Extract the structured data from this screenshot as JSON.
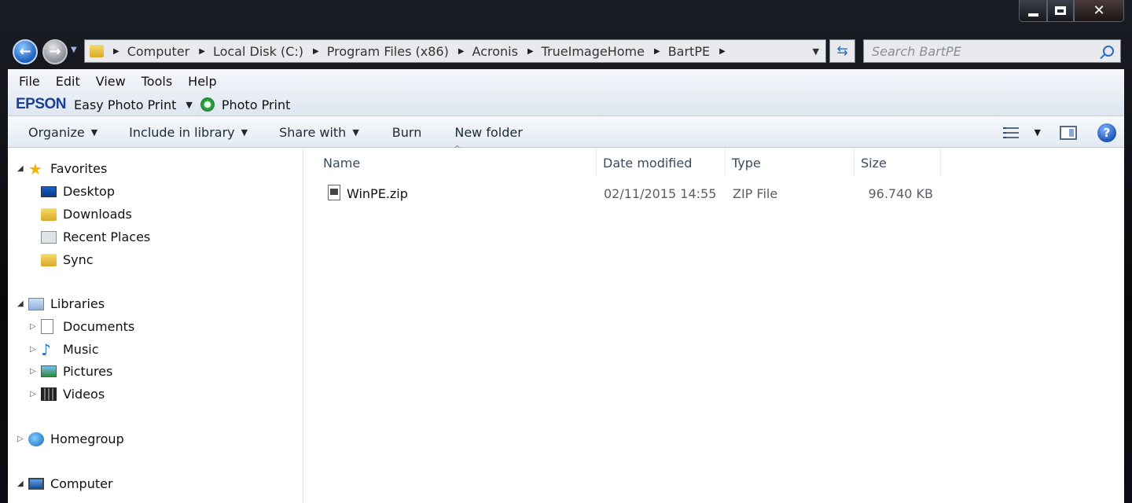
{
  "address_bar": {
    "breadcrumbs": [
      "Computer",
      "Local Disk (C:)",
      "Program Files (x86)",
      "Acronis",
      "TrueImageHome",
      "BartPE"
    ]
  },
  "search": {
    "placeholder": "Search BartPE"
  },
  "menu": [
    "File",
    "Edit",
    "View",
    "Tools",
    "Help"
  ],
  "epson_bar": {
    "logo": "EPSON",
    "easy_photo_print": "Easy Photo Print",
    "photo_print": "Photo Print"
  },
  "toolbar": {
    "organize": "Organize",
    "include_in_library": "Include in library",
    "share_with": "Share with",
    "burn": "Burn",
    "new_folder": "New folder"
  },
  "nav_pane": {
    "favorites": {
      "label": "Favorites",
      "items": [
        "Desktop",
        "Downloads",
        "Recent Places",
        "Sync"
      ]
    },
    "libraries": {
      "label": "Libraries",
      "items": [
        "Documents",
        "Music",
        "Pictures",
        "Videos"
      ]
    },
    "homegroup": "Homegroup",
    "computer": "Computer"
  },
  "columns": {
    "name": "Name",
    "date_modified": "Date modified",
    "type": "Type",
    "size": "Size"
  },
  "files": [
    {
      "name": "WinPE.zip",
      "date_modified": "02/11/2015 14:55",
      "type": "ZIP File",
      "size": "96.740 KB"
    }
  ],
  "colors": {
    "frame": "#0d0f14",
    "accent": "#2c6cc4",
    "epson_blue": "#1a3f9a"
  }
}
